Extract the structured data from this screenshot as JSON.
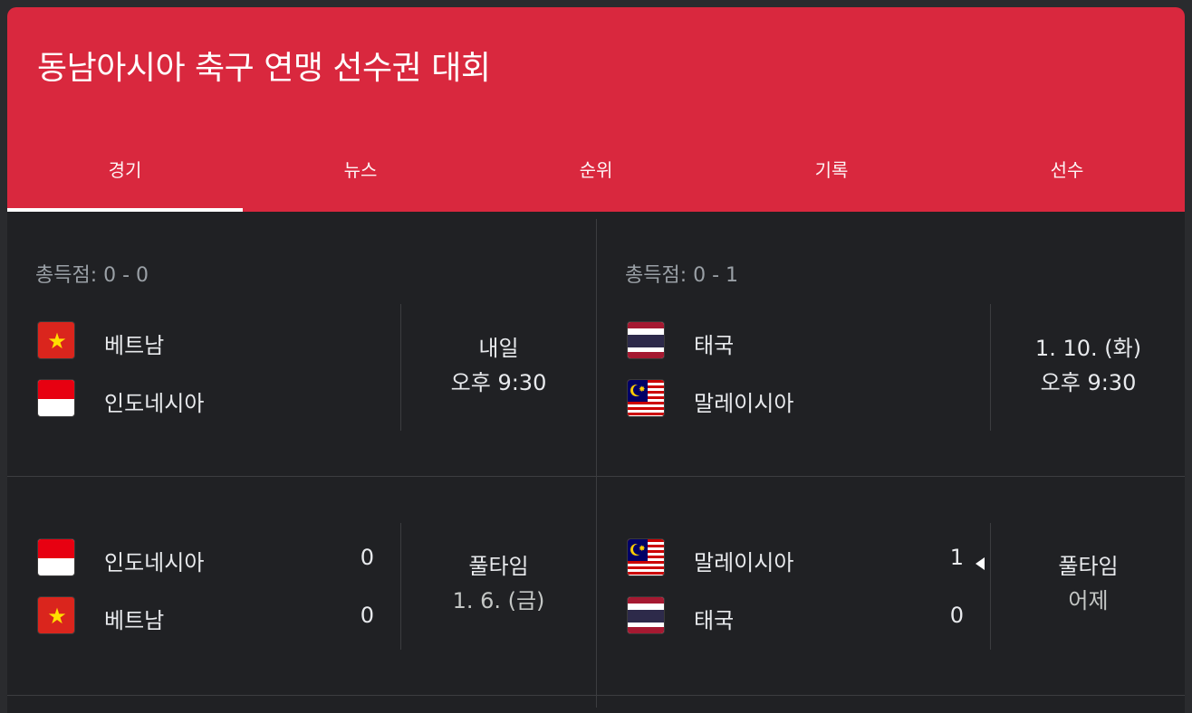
{
  "header": {
    "title": "동남아시아 축구 연맹 선수권 대회",
    "tabs": [
      {
        "label": "경기",
        "active": true
      },
      {
        "label": "뉴스",
        "active": false
      },
      {
        "label": "순위",
        "active": false
      },
      {
        "label": "기록",
        "active": false
      },
      {
        "label": "선수",
        "active": false
      }
    ]
  },
  "matches": [
    {
      "aggregate": "총득점: 0 - 0",
      "home": {
        "name": "베트남",
        "flag": "vietnam-flag",
        "score": ""
      },
      "away": {
        "name": "인도네시아",
        "flag": "indonesia-flag",
        "score": ""
      },
      "status_line1": "내일",
      "status_line2": "오후 9:30"
    },
    {
      "aggregate": "총득점: 0 - 1",
      "home": {
        "name": "태국",
        "flag": "thailand-flag",
        "score": ""
      },
      "away": {
        "name": "말레이시아",
        "flag": "malaysia-flag",
        "score": ""
      },
      "status_line1": "1. 10. (화)",
      "status_line2": "오후 9:30"
    },
    {
      "aggregate": "",
      "home": {
        "name": "인도네시아",
        "flag": "indonesia-flag",
        "score": "0"
      },
      "away": {
        "name": "베트남",
        "flag": "vietnam-flag",
        "score": "0"
      },
      "status_line1": "풀타임",
      "status_line2": "1. 6. (금)"
    },
    {
      "aggregate": "",
      "home": {
        "name": "말레이시아",
        "flag": "malaysia-flag",
        "score": "1",
        "winner": true
      },
      "away": {
        "name": "태국",
        "flag": "thailand-flag",
        "score": "0"
      },
      "status_line1": "풀타임",
      "status_line2": "어제"
    }
  ],
  "colors": {
    "header_bg": "#d9283e",
    "card_bg": "#202124",
    "text": "#e8eaed",
    "muted": "#9aa0a6"
  }
}
